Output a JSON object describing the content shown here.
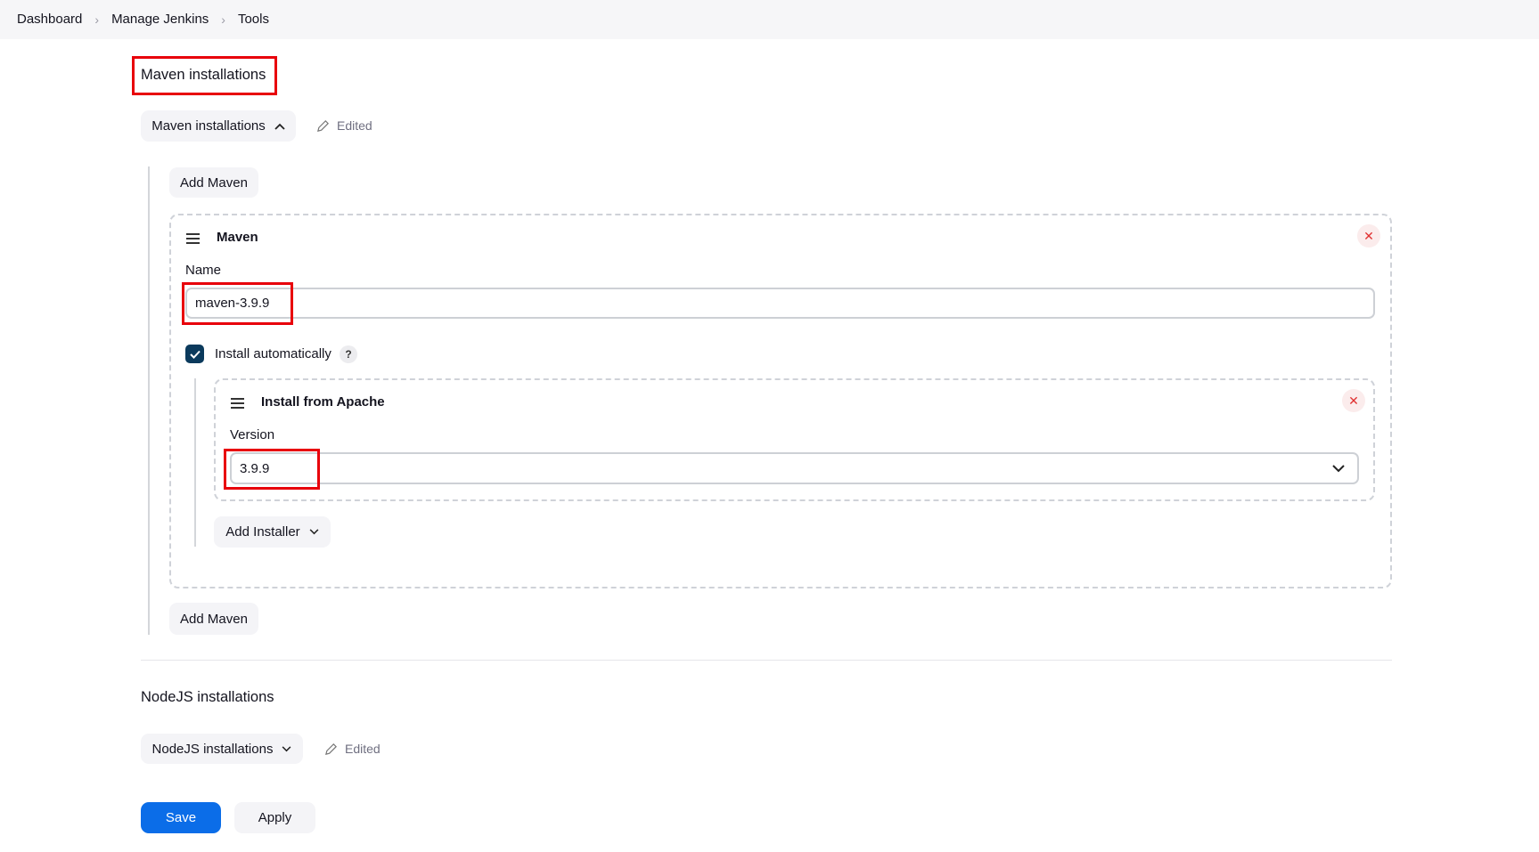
{
  "breadcrumb": [
    "Dashboard",
    "Manage Jenkins",
    "Tools"
  ],
  "maven": {
    "heading": "Maven installations",
    "toggle_label": "Maven installations",
    "edited_label": "Edited",
    "add_button": "Add Maven",
    "card": {
      "title": "Maven",
      "name_label": "Name",
      "name_value": "maven-3.9.9",
      "install_auto_label": "Install automatically",
      "install_auto_checked": true,
      "help": "?",
      "installer": {
        "title": "Install from Apache",
        "version_label": "Version",
        "version_value": "3.9.9"
      },
      "add_installer": "Add Installer"
    }
  },
  "nodejs": {
    "heading": "NodeJS installations",
    "toggle_label": "NodeJS installations",
    "edited_label": "Edited"
  },
  "actions": {
    "save": "Save",
    "apply": "Apply"
  },
  "colors": {
    "accent": "#0b6de8",
    "highlight": "#e8000b",
    "checkbox": "#0b3a5c"
  }
}
